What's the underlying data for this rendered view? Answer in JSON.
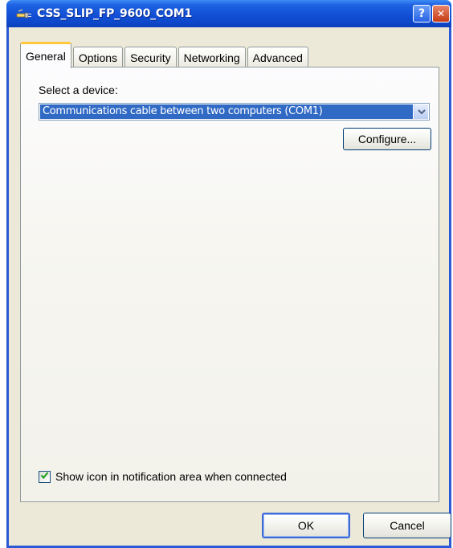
{
  "window": {
    "title": "CSS_SLIP_FP_9600_COM1",
    "help_glyph": "?",
    "close_glyph": "✕"
  },
  "tabs": [
    {
      "label": "General",
      "active": true
    },
    {
      "label": "Options",
      "active": false
    },
    {
      "label": "Security",
      "active": false
    },
    {
      "label": "Networking",
      "active": false
    },
    {
      "label": "Advanced",
      "active": false
    }
  ],
  "general": {
    "select_label": "Select a device:",
    "device_value": "Communications cable between two computers (COM1)",
    "configure_label": "Configure...",
    "show_icon_label": "Show icon in notification area when connected",
    "show_icon_checked": true
  },
  "footer": {
    "ok_label": "OK",
    "cancel_label": "Cancel"
  },
  "icons": {
    "title": "connection-icon",
    "help": "help-icon",
    "close": "close-icon",
    "dropdown": "chevron-down-icon",
    "check": "checkmark-icon"
  },
  "colors": {
    "titlebar": "#0e47c9",
    "selection": "#316ac5",
    "active_tab_accent": "#ffc83c",
    "dialog_face": "#ece9d8"
  }
}
